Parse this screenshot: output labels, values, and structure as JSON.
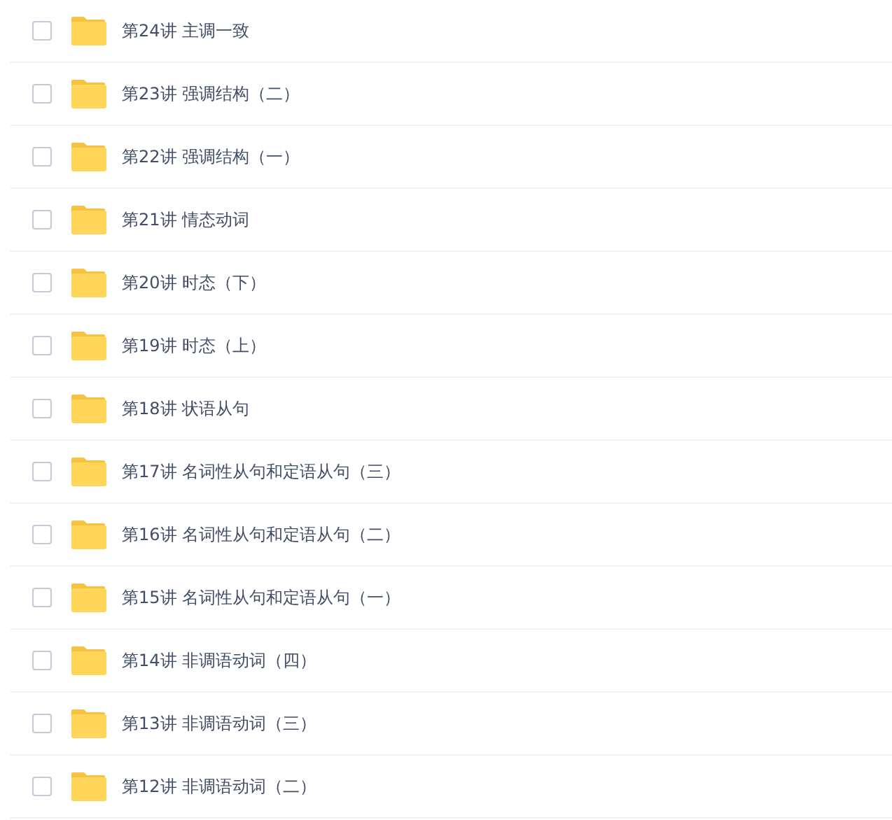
{
  "files": [
    {
      "name": "第24讲 主调一致",
      "checked": false
    },
    {
      "name": "第23讲 强调结构（二）",
      "checked": false
    },
    {
      "name": "第22讲 强调结构（一）",
      "checked": false
    },
    {
      "name": "第21讲 情态动词",
      "checked": false
    },
    {
      "name": "第20讲 时态（下）",
      "checked": false
    },
    {
      "name": "第19讲 时态（上）",
      "checked": false
    },
    {
      "name": "第18讲 状语从句",
      "checked": false
    },
    {
      "name": "第17讲 名词性从句和定语从句（三）",
      "checked": false
    },
    {
      "name": "第16讲 名词性从句和定语从句（二）",
      "checked": false
    },
    {
      "name": "第15讲 名词性从句和定语从句（一）",
      "checked": false
    },
    {
      "name": "第14讲 非调语动词（四）",
      "checked": false
    },
    {
      "name": "第13讲 非调语动词（三）",
      "checked": false
    },
    {
      "name": "第12讲 非调语动词（二）",
      "checked": false
    }
  ]
}
